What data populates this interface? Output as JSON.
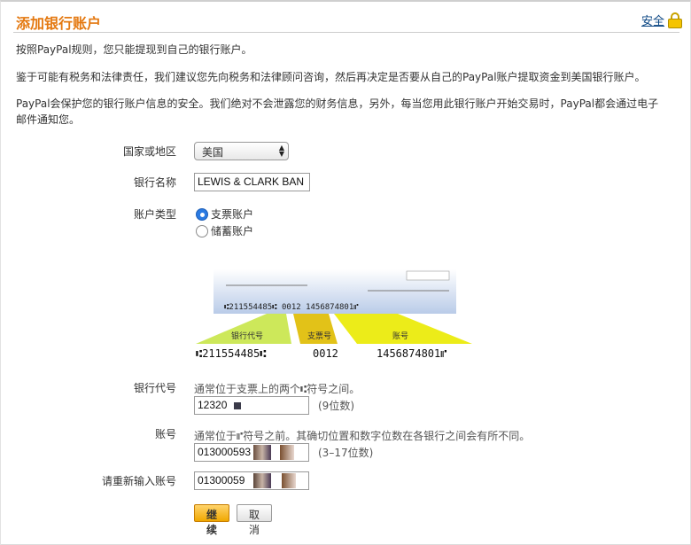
{
  "header": {
    "title": "添加银行账户",
    "security_label": "安全"
  },
  "intro": {
    "p1": "按照PayPal规则，您只能提现到自己的银行账户。",
    "p2": "鉴于可能有税务和法律责任，我们建议您先向税务和法律顾问咨询，然后再决定是否要从自己的PayPal账户提取资金到美国银行账户。",
    "p3": "PayPal会保护您的银行账户信息的安全。我们绝对不会泄露您的财务信息，另外，每当您用此银行账户开始交易时，PayPal都会通过电子邮件通知您。"
  },
  "form": {
    "country": {
      "label": "国家或地区",
      "value": "美国"
    },
    "bank_name": {
      "label": "银行名称",
      "value": "LEWIS & CLARK BAN"
    },
    "account_type": {
      "label": "账户类型",
      "options": [
        {
          "label": "支票账户",
          "selected": true
        },
        {
          "label": "储蓄账户",
          "selected": false
        }
      ]
    },
    "routing": {
      "label": "银行代号",
      "hint": "通常位于支票上的两个⑆符号之间。",
      "value": "12320",
      "suffix": "(9位数)"
    },
    "account": {
      "label": "账号",
      "hint": "通常位于⑈符号之前。其确切位置和数字位数在各银行之间会有所不同。",
      "value": "013000593",
      "suffix": "(3–17位数)"
    },
    "account_confirm": {
      "label": "请重新输入账号",
      "value": "01300059"
    }
  },
  "check_diagram": {
    "micr_line": "⑆211554485⑆  0012    1456874801⑈",
    "tag_routing": "银行代号",
    "tag_check": "支票号",
    "tag_account": "账号",
    "routing_number": "⑆211554485⑆",
    "check_number": "0012",
    "account_number": "1456874801⑈",
    "colors": {
      "routing": "#cde85a",
      "check": "#e2c218",
      "account": "#ecec19",
      "check_bg": "#c9d6ea"
    }
  },
  "buttons": {
    "continue": "继续",
    "cancel": "取消"
  }
}
